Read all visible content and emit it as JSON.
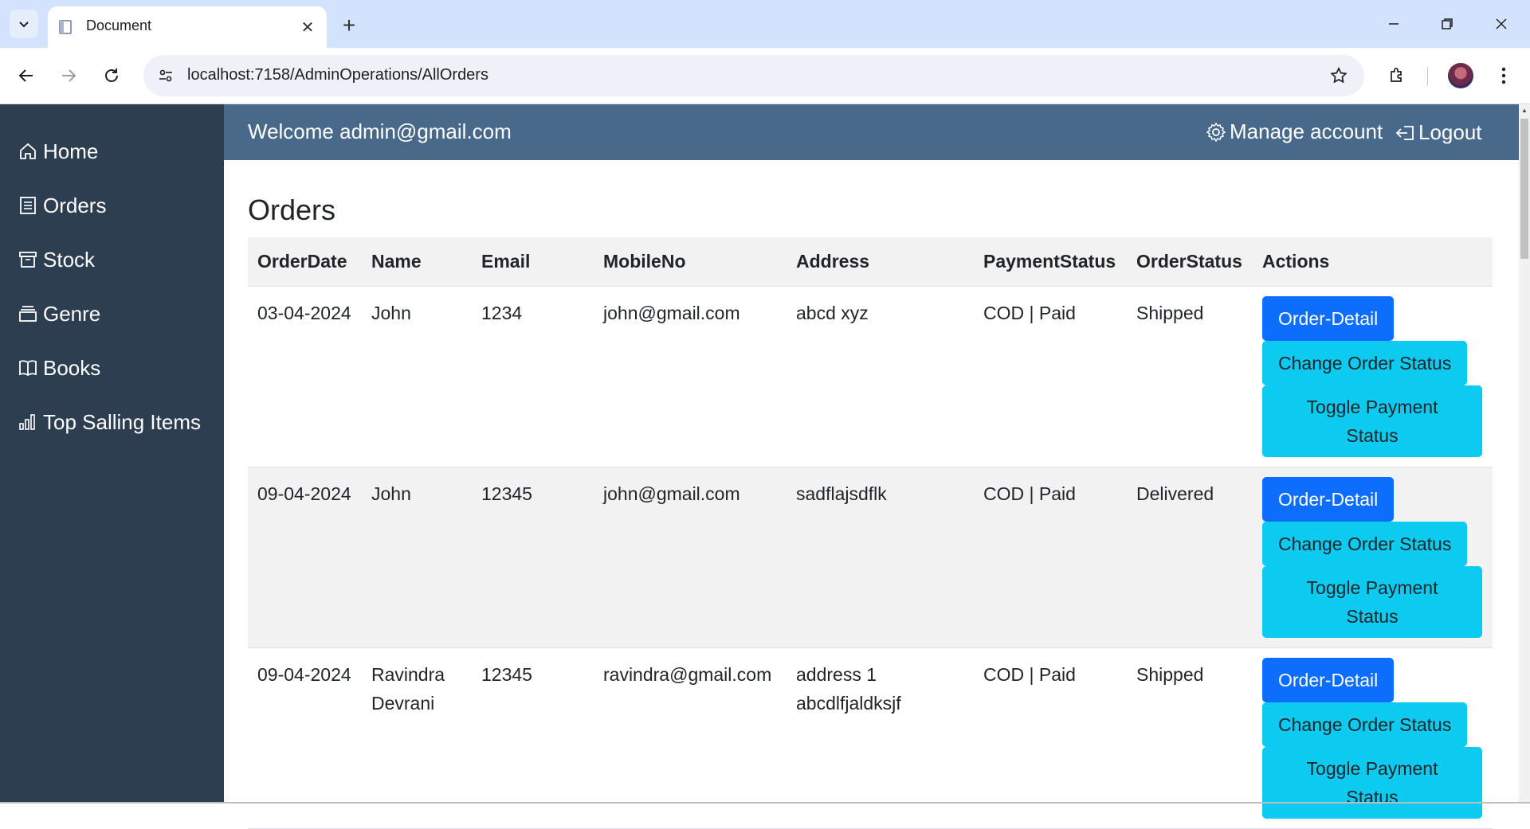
{
  "browser": {
    "tab_title": "Document",
    "url": "localhost:7158/AdminOperations/AllOrders"
  },
  "sidebar": {
    "items": [
      {
        "label": "Home",
        "icon": "home-icon"
      },
      {
        "label": "Orders",
        "icon": "orders-icon"
      },
      {
        "label": "Stock",
        "icon": "archive-icon"
      },
      {
        "label": "Genre",
        "icon": "stack-icon"
      },
      {
        "label": "Books",
        "icon": "book-icon"
      },
      {
        "label": "Top Salling Items",
        "icon": "bar-chart-icon"
      }
    ]
  },
  "header": {
    "welcome": "Welcome admin@gmail.com",
    "manage_account": "Manage account",
    "logout": "Logout"
  },
  "main": {
    "title": "Orders",
    "columns": [
      "OrderDate",
      "Name",
      "Email",
      "MobileNo",
      "Address",
      "PaymentStatus",
      "OrderStatus",
      "Actions"
    ],
    "rows": [
      {
        "date": "03-04-2024",
        "name": "John",
        "email": "1234",
        "mobile": "john@gmail.com",
        "address": "abcd xyz",
        "payment": "COD | Paid",
        "status": "Shipped"
      },
      {
        "date": "09-04-2024",
        "name": "John",
        "email": "12345",
        "mobile": "john@gmail.com",
        "address": "sadflajsdflk",
        "payment": "COD | Paid",
        "status": "Delivered"
      },
      {
        "date": "09-04-2024",
        "name": "Ravindra Devrani",
        "email": "12345",
        "mobile": "ravindra@gmail.com",
        "address": "address 1 abcdlfjaldksjf",
        "payment": "COD | Paid",
        "status": "Shipped"
      }
    ],
    "buttons": {
      "detail": "Order-Detail",
      "change_status": "Change Order Status",
      "toggle_payment": "Toggle Payment Status"
    }
  },
  "colors": {
    "sidebar_bg": "#2c3e50",
    "topbar_bg": "#48698a",
    "primary": "#0d6efd",
    "info": "#0dcaf0"
  }
}
